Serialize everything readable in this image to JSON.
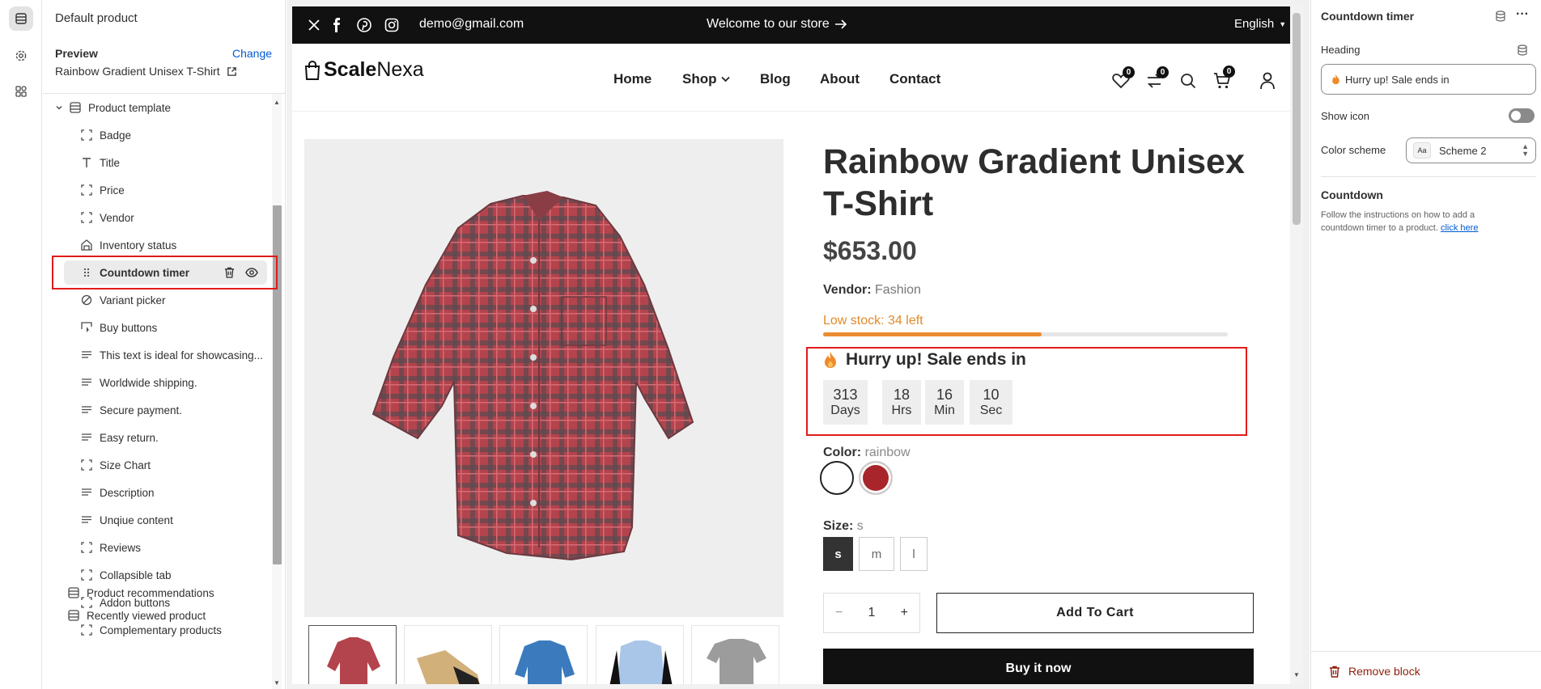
{
  "left_panel": {
    "title": "Default product",
    "preview_label": "Preview",
    "change_label": "Change",
    "product_name": "Rainbow Gradient Unisex T-Shirt",
    "section_label": "Product template",
    "blocks": [
      {
        "label": "Badge",
        "icon": "block-icon"
      },
      {
        "label": "Title",
        "icon": "text-icon"
      },
      {
        "label": "Price",
        "icon": "block-icon"
      },
      {
        "label": "Vendor",
        "icon": "block-icon"
      },
      {
        "label": "Inventory status",
        "icon": "inventory-icon"
      },
      {
        "label": "Countdown timer",
        "icon": "drag-handle-icon"
      },
      {
        "label": "Variant picker",
        "icon": "variant-icon"
      },
      {
        "label": "Buy buttons",
        "icon": "buy-icon"
      },
      {
        "label": "This text is ideal for showcasing...",
        "icon": "paragraph-icon"
      },
      {
        "label": "Worldwide shipping.",
        "icon": "paragraph-icon"
      },
      {
        "label": "Secure payment.",
        "icon": "paragraph-icon"
      },
      {
        "label": "Easy return.",
        "icon": "paragraph-icon"
      },
      {
        "label": "Size Chart",
        "icon": "block-icon"
      },
      {
        "label": "Description",
        "icon": "paragraph-icon"
      },
      {
        "label": "Unqiue content",
        "icon": "paragraph-icon"
      },
      {
        "label": "Reviews",
        "icon": "block-icon"
      },
      {
        "label": "Collapsible tab",
        "icon": "block-icon"
      },
      {
        "label": "Addon buttons",
        "icon": "block-icon"
      },
      {
        "label": "Complementary products",
        "icon": "block-icon"
      }
    ],
    "sections": [
      "Product recommendations",
      "Recently viewed product"
    ]
  },
  "store": {
    "email": "demo@gmail.com",
    "welcome": "Welcome to our store",
    "language": "English",
    "logo_bold": "Scale",
    "logo_light": "Nexa",
    "nav": [
      "Home",
      "Shop",
      "Blog",
      "About",
      "Contact"
    ],
    "badges": {
      "wishlist": "0",
      "compare": "0",
      "cart": "0"
    },
    "product_title": "Rainbow Gradient Unisex T-Shirt",
    "price": "$653.00",
    "vendor_label": "Vendor:",
    "vendor_value": "Fashion",
    "low_stock": "Low stock: 34 left",
    "stock_fill_fraction": 0.54,
    "hurry_text": "Hurry up! Sale ends in",
    "countdown": [
      {
        "value": "313",
        "unit": "Days"
      },
      {
        "value": "18",
        "unit": "Hrs"
      },
      {
        "value": "16",
        "unit": "Min"
      },
      {
        "value": "10",
        "unit": "Sec"
      }
    ],
    "color_label": "Color:",
    "color_value": "rainbow",
    "swatch_colors": [
      "#ffffff",
      "#a8262b"
    ],
    "size_label": "Size:",
    "size_value": "s",
    "sizes": [
      "s",
      "m",
      "l"
    ],
    "qty_minus": "−",
    "qty_value": "1",
    "qty_plus": "+",
    "add_to_cart": "Add To Cart",
    "buy_now": "Buy it now"
  },
  "right_panel": {
    "title": "Countdown timer",
    "heading_label": "Heading",
    "heading_value": "Hurry up! Sale ends in",
    "show_icon_label": "Show icon",
    "show_icon_on": false,
    "color_scheme_label": "Color scheme",
    "color_scheme_value": "Scheme 2",
    "scheme_swatch_text": "Aa",
    "countdown_title": "Countdown",
    "countdown_desc": "Follow the instructions on how to add a countdown timer to a product.",
    "click_here": "click here",
    "remove_block": "Remove block"
  },
  "colors": {
    "highlight": "#e11b1b",
    "accent": "#005bd3",
    "stock_bar": "#ec8b2f",
    "danger": "#8e1f0b"
  }
}
